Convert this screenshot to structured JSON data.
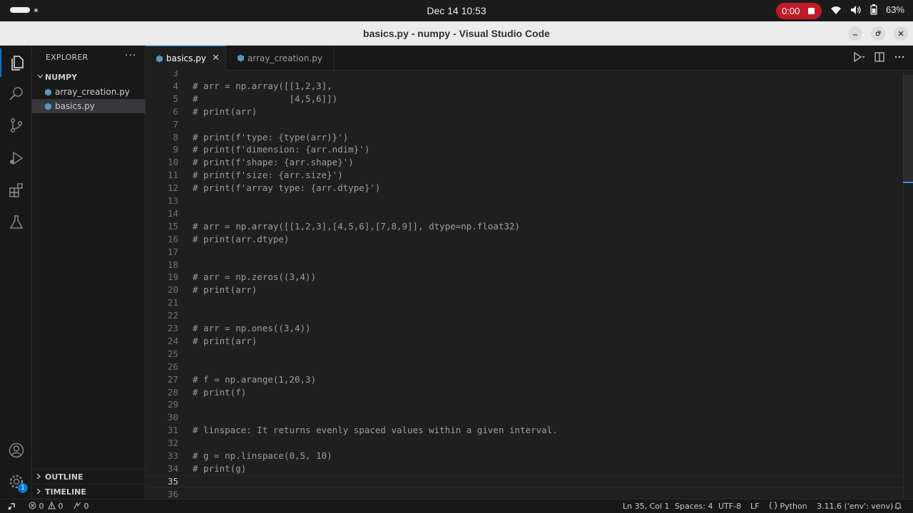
{
  "topbar": {
    "clock": "Dec 14  10:53",
    "recording_time": "0:00",
    "battery": "63%"
  },
  "window": {
    "title": "basics.py - numpy - Visual Studio Code"
  },
  "activity_badge": "1",
  "sidebar": {
    "header": "EXPLORER",
    "more": "···",
    "folder": "NUMPY",
    "files": [
      "array_creation.py",
      "basics.py"
    ],
    "outline": "OUTLINE",
    "timeline": "TIMELINE"
  },
  "tabs": {
    "active": "basics.py",
    "inactive": "array_creation.py",
    "close": "✕"
  },
  "editor": {
    "lines": [
      {
        "n": "3",
        "t": ""
      },
      {
        "n": "4",
        "t": "# arr = np.array([[1,2,3],"
      },
      {
        "n": "5",
        "t": "#                 [4,5,6]])"
      },
      {
        "n": "6",
        "t": "# print(arr)"
      },
      {
        "n": "7",
        "t": ""
      },
      {
        "n": "8",
        "t": "# print(f'type: {type(arr)}')"
      },
      {
        "n": "9",
        "t": "# print(f'dimension: {arr.ndim}')"
      },
      {
        "n": "10",
        "t": "# print(f'shape: {arr.shape}')"
      },
      {
        "n": "11",
        "t": "# print(f'size: {arr.size}')"
      },
      {
        "n": "12",
        "t": "# print(f'array type: {arr.dtype}')"
      },
      {
        "n": "13",
        "t": ""
      },
      {
        "n": "14",
        "t": ""
      },
      {
        "n": "15",
        "t": "# arr = np.array([[1,2,3],[4,5,6],[7,8,9]], dtype=np.float32)"
      },
      {
        "n": "16",
        "t": "# print(arr.dtype)"
      },
      {
        "n": "17",
        "t": ""
      },
      {
        "n": "18",
        "t": ""
      },
      {
        "n": "19",
        "t": "# arr = np.zeros((3,4))"
      },
      {
        "n": "20",
        "t": "# print(arr)"
      },
      {
        "n": "21",
        "t": ""
      },
      {
        "n": "22",
        "t": ""
      },
      {
        "n": "23",
        "t": "# arr = np.ones((3,4))"
      },
      {
        "n": "24",
        "t": "# print(arr)"
      },
      {
        "n": "25",
        "t": ""
      },
      {
        "n": "26",
        "t": ""
      },
      {
        "n": "27",
        "t": "# f = np.arange(1,20,3)"
      },
      {
        "n": "28",
        "t": "# print(f)"
      },
      {
        "n": "29",
        "t": ""
      },
      {
        "n": "30",
        "t": ""
      },
      {
        "n": "31",
        "t": "# linspace: It returns evenly spaced values within a given interval."
      },
      {
        "n": "32",
        "t": ""
      },
      {
        "n": "33",
        "t": "# g = np.linspace(0,5, 10)"
      },
      {
        "n": "34",
        "t": "# print(g)"
      },
      {
        "n": "35",
        "t": ""
      },
      {
        "n": "36",
        "t": ""
      }
    ],
    "current_line": "35"
  },
  "statusbar": {
    "errors": "0",
    "warnings": "0",
    "ports": "0",
    "position": "Ln 35, Col 1",
    "spaces": "Spaces: 4",
    "encoding": "UTF-8",
    "eol": "LF",
    "language": "Python",
    "interpreter": "3.11.6 ('env': venv)"
  }
}
